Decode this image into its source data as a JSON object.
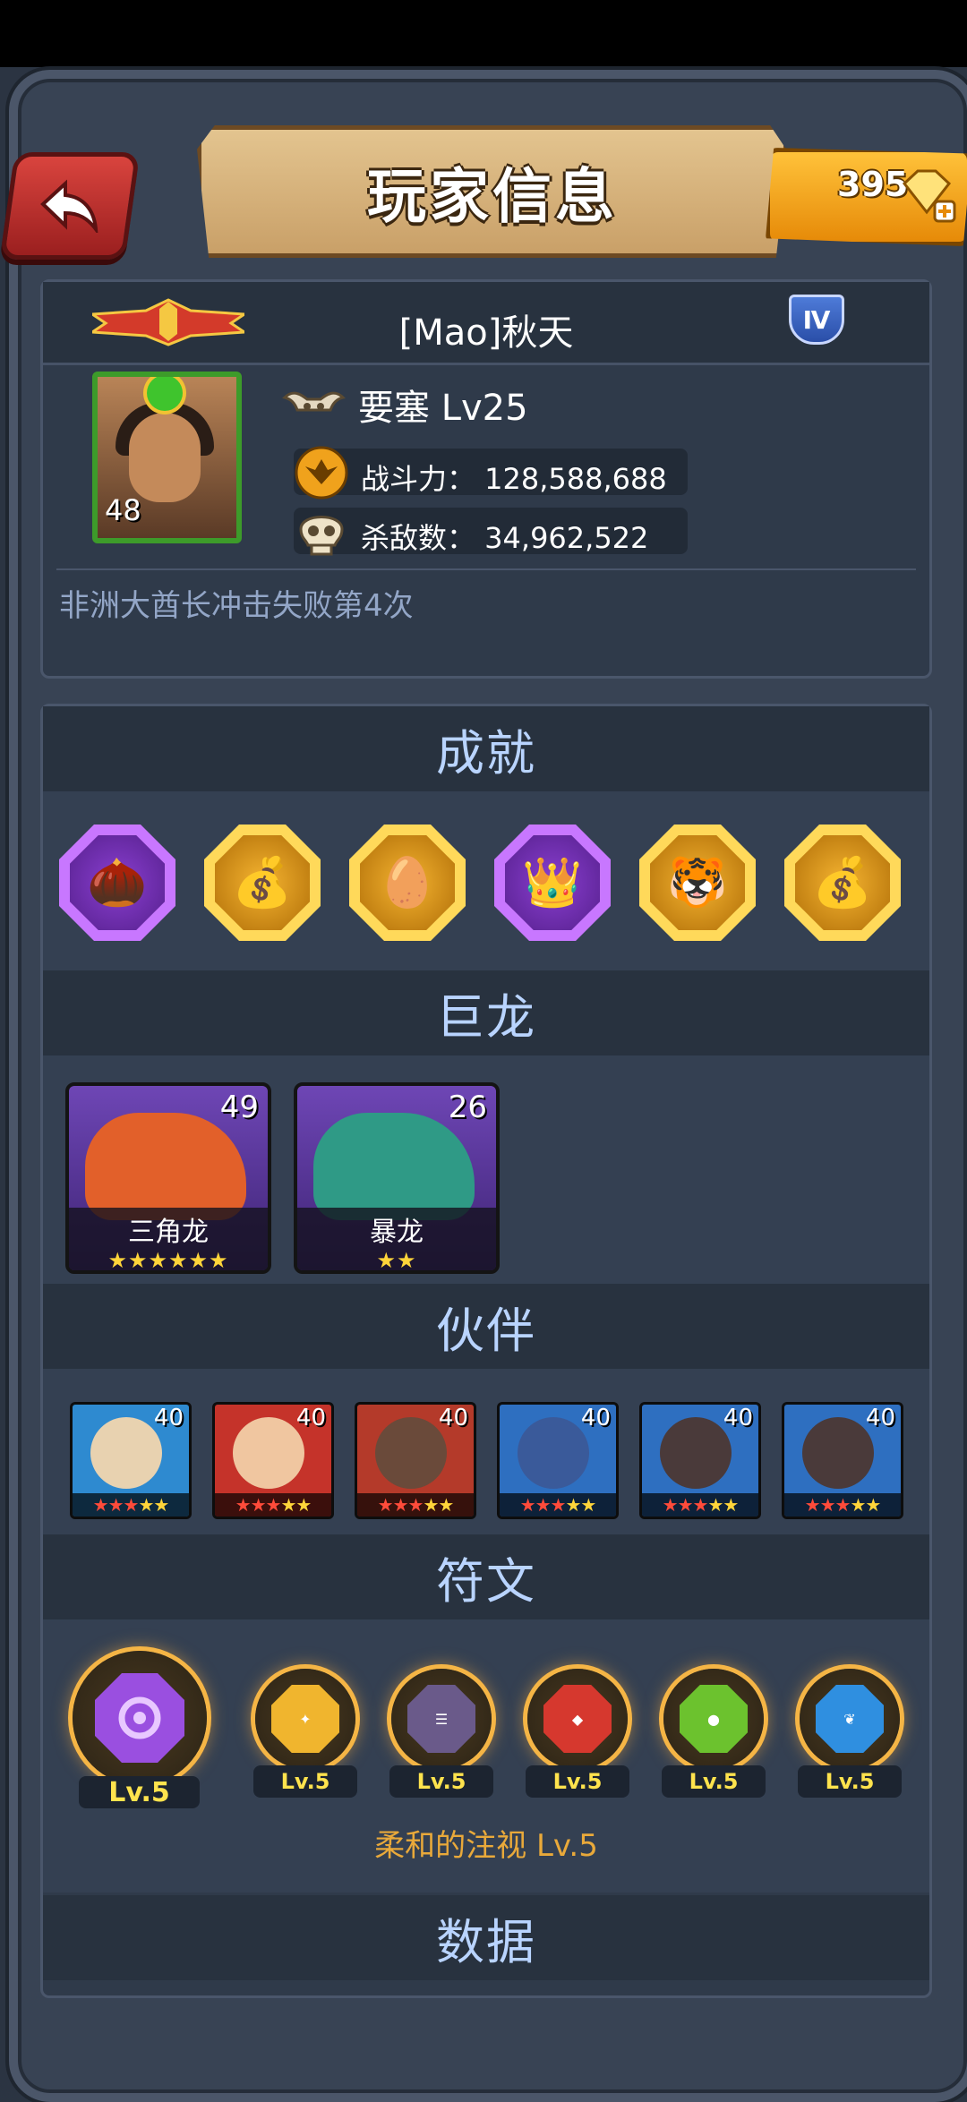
{
  "header": {
    "title": "玩家信息",
    "gems": "395"
  },
  "profile": {
    "name": "[Mao]秋天",
    "tier": "Ⅳ",
    "avatar_level": "48",
    "title": "要塞 Lv25",
    "power": "战斗力： 128,588,688",
    "kills": "杀敌数： 34,962,522",
    "motto": "非洲大酋长冲击失败第4次"
  },
  "sections": {
    "achievements": "成就",
    "dragons": "巨龙",
    "partners": "伙伴",
    "runes": "符文",
    "stats": "数据"
  },
  "achievements": [
    {
      "icon": "acorn-icon",
      "style": "purple"
    },
    {
      "icon": "gold-ore-icon",
      "style": "gold"
    },
    {
      "icon": "egg-icon",
      "style": "gold"
    },
    {
      "icon": "king-face-icon",
      "style": "purple"
    },
    {
      "icon": "ice-tiger-icon",
      "style": "gold"
    },
    {
      "icon": "money-bag-icon",
      "style": "gold"
    }
  ],
  "dragons": [
    {
      "name": "三角龙",
      "level": "49",
      "stars": "★★★★★★"
    },
    {
      "name": "暴龙",
      "level": "26",
      "stars": "★★"
    }
  ],
  "partners": [
    {
      "level": "40",
      "red": "★★★",
      "yellow": "★★"
    },
    {
      "level": "40",
      "red": "★★★",
      "yellow": "★★"
    },
    {
      "level": "40",
      "red": "★★★",
      "yellow": "★★"
    },
    {
      "level": "40",
      "red": "★★★",
      "yellow": "★★"
    },
    {
      "level": "40",
      "red": "★★★",
      "yellow": "★★"
    },
    {
      "level": "40",
      "red": "★★★",
      "yellow": "★★"
    }
  ],
  "runes": [
    {
      "level": "Lv.5",
      "color": "#9a4fe0"
    },
    {
      "level": "Lv.5",
      "color": "#f0b52e"
    },
    {
      "level": "Lv.5",
      "color": "#6a5a8a"
    },
    {
      "level": "Lv.5",
      "color": "#d6382e"
    },
    {
      "level": "Lv.5",
      "color": "#6cc22e"
    },
    {
      "level": "Lv.5",
      "color": "#2f8fe0"
    }
  ],
  "rune_caption": "柔和的注视 Lv.5",
  "colors": {
    "accent": "#b9d4ff",
    "gold": "#f5b545",
    "rune_caption": "#e9a93a"
  }
}
